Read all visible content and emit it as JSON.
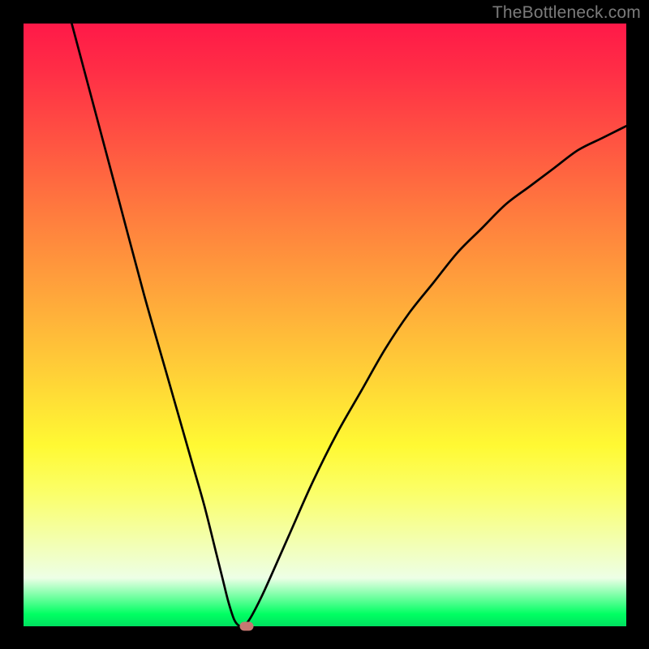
{
  "watermark": "TheBottleneck.com",
  "chart_data": {
    "type": "line",
    "title": "",
    "xlabel": "",
    "ylabel": "",
    "xlim": [
      0,
      100
    ],
    "ylim": [
      0,
      100
    ],
    "background_gradient": {
      "description": "vertical gradient from red (high/bad) through orange, yellow to green (low/good)",
      "stops": [
        {
          "pos": 0,
          "color": "#ff1948"
        },
        {
          "pos": 8,
          "color": "#ff2e46"
        },
        {
          "pos": 20,
          "color": "#ff5542"
        },
        {
          "pos": 32,
          "color": "#ff7d3e"
        },
        {
          "pos": 45,
          "color": "#ffa63b"
        },
        {
          "pos": 58,
          "color": "#ffd037"
        },
        {
          "pos": 70,
          "color": "#fff933"
        },
        {
          "pos": 78,
          "color": "#fbff6a"
        },
        {
          "pos": 85,
          "color": "#f4ffa8"
        },
        {
          "pos": 92,
          "color": "#edffe6"
        },
        {
          "pos": 98,
          "color": "#00ff62"
        },
        {
          "pos": 100,
          "color": "#00e060"
        }
      ]
    },
    "series": [
      {
        "name": "bottleneck-curve",
        "description": "V-shaped curve; steep left branch, shallower right branch, minimum near x≈36",
        "x": [
          8,
          12,
          16,
          20,
          24,
          28,
          30,
          32,
          33,
          34,
          35,
          36,
          37,
          38,
          40,
          44,
          48,
          52,
          56,
          60,
          64,
          68,
          72,
          76,
          80,
          84,
          88,
          92,
          96,
          100
        ],
        "y": [
          100,
          85,
          70,
          55,
          41,
          27,
          20,
          12,
          8,
          4,
          1,
          0,
          0.5,
          2,
          6,
          15,
          24,
          32,
          39,
          46,
          52,
          57,
          62,
          66,
          70,
          73,
          76,
          79,
          81,
          83
        ]
      }
    ],
    "marker": {
      "name": "optimal-point",
      "x": 37,
      "y": 0,
      "color": "#c77872"
    }
  }
}
